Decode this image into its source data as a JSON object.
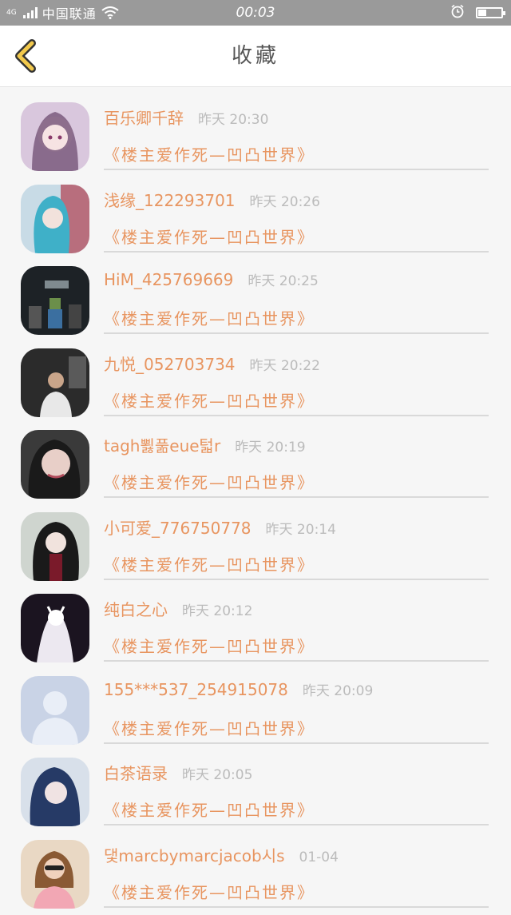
{
  "status_bar": {
    "network": "4G",
    "carrier": "中国联通",
    "time": "00:03",
    "battery_level": 0.35
  },
  "header": {
    "title": "收藏",
    "back_icon": "chevron-left-icon",
    "accent_color": "#f2c94c"
  },
  "favorites": [
    {
      "username": "百乐卿千辞",
      "time": "昨天 20:30",
      "post": "《楼主爱作死—凹凸世界》",
      "avatar": "anime-girl-purple"
    },
    {
      "username": "浅缘_122293701",
      "time": "昨天 20:26",
      "post": "《楼主爱作死—凹凸世界》",
      "avatar": "anime-girl-cyan"
    },
    {
      "username": "HiM_425769669",
      "time": "昨天 20:25",
      "post": "《楼主爱作死—凹凸世界》",
      "avatar": "minecraft-scene"
    },
    {
      "username": "九悦_052703734",
      "time": "昨天 20:22",
      "post": "《楼主爱作死—凹凸世界》",
      "avatar": "man-photo"
    },
    {
      "username": "tagh뾣풂eue턻r",
      "time": "昨天 20:19",
      "post": "《楼主爱作死—凹凸世界》",
      "avatar": "girl-photo"
    },
    {
      "username": "小可爱_776750778",
      "time": "昨天 20:14",
      "post": "《楼主爱作死—凹凸世界》",
      "avatar": "anime-girl-dark"
    },
    {
      "username": "纯白之心",
      "time": "昨天 20:12",
      "post": "《楼主爱作死—凹凸世界》",
      "avatar": "anime-white-figure"
    },
    {
      "username": "155***537_254915078",
      "time": "昨天 20:09",
      "post": "《楼主爱作死—凹凸世界》",
      "avatar": "default-avatar"
    },
    {
      "username": "白茶语录",
      "time": "昨天 20:05",
      "post": "《楼主爱作死—凹凸世界》",
      "avatar": "anime-girl-blue"
    },
    {
      "username": "댗marcbymarcjacob시s",
      "time": "01-04",
      "post": "《楼主爱作死—凹凸世界》",
      "avatar": "girl-sunglasses"
    }
  ]
}
